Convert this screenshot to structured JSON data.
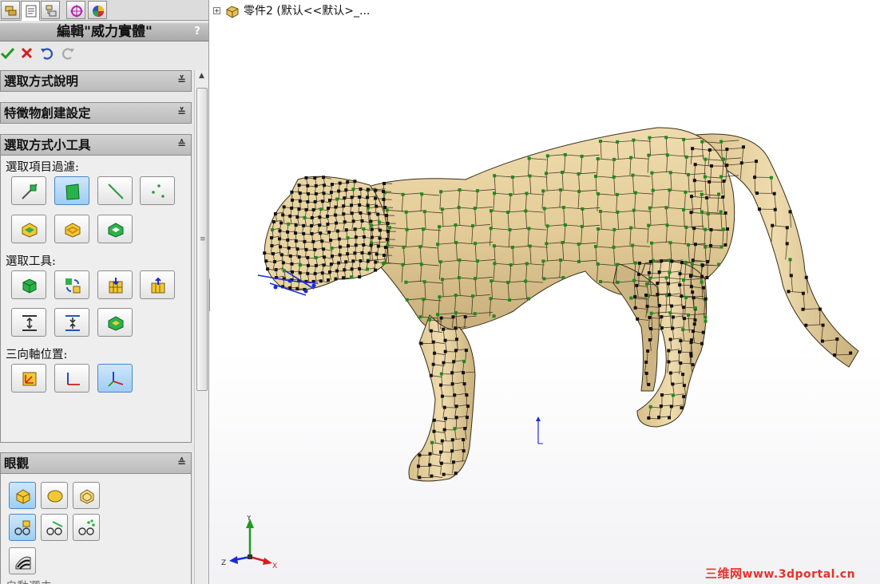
{
  "panel": {
    "title": "編輯\"威力實體\"",
    "help_label": "?",
    "tabs": [
      "featuremanager-icon",
      "propertymanager-icon",
      "configurationmanager-icon",
      "dimxpert-icon",
      "display-manager-icon"
    ],
    "groups": {
      "selection_help": {
        "title": "選取方式說明",
        "chevron": "≚"
      },
      "creation_settings": {
        "title": "特徵物創建設定",
        "chevron": "≚"
      },
      "selection_tools": {
        "title": "選取方式小工具",
        "chevron": "≙"
      },
      "appearance": {
        "title": "眼觀",
        "chevron": "≙"
      }
    },
    "labels": {
      "filter": "選取項目過濾:",
      "tools": "選取工具:",
      "triad": "三向軸位置:",
      "bottom_partial": "自動選去"
    }
  },
  "viewport": {
    "tree_expander": "+",
    "part_name": "零件2 (默认<<默认>_..."
  },
  "triad_axes": {
    "x": "X",
    "y": "Y",
    "z": "Z"
  },
  "watermark": {
    "cn": "三维网",
    "url": "www.3dportal.cn"
  },
  "colors": {
    "mesh_face": "#e6d3a3",
    "mesh_face_light": "#f4e6bf",
    "mesh_face_dark": "#b9a276",
    "vertex": "#111111",
    "crease_vertex": "#1f8a1f",
    "selection": "#1a2bd6",
    "active_tool": "#9fcdf3"
  }
}
